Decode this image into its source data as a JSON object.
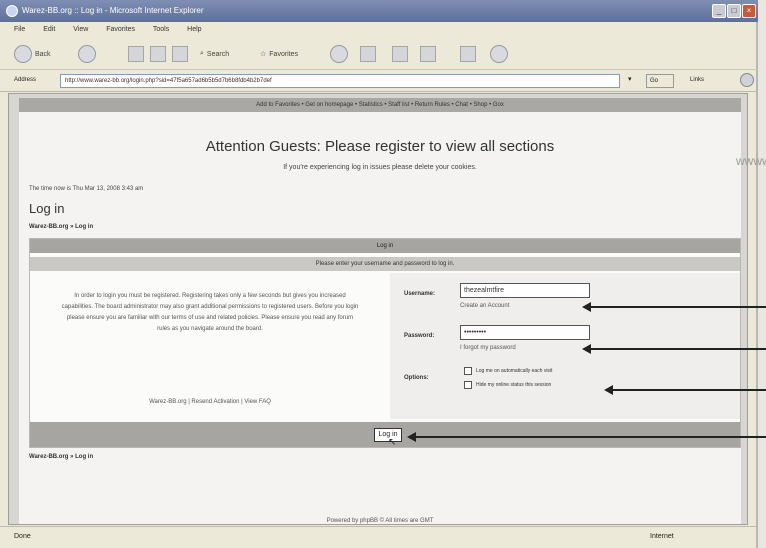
{
  "window": {
    "title": "Warez-BB.org :: Log in - Microsoft Internet Explorer",
    "menu": [
      "File",
      "Edit",
      "View",
      "Favorites",
      "Tools",
      "Help"
    ],
    "toolbar": {
      "back": "Back",
      "search": "Search",
      "favorites": "Favorites"
    },
    "address_label": "Address",
    "address_value": "http://www.warez-bb.org/login.php?sid=47f5a657ad6b5b5d7b6b8fdb4b2b7def",
    "go_label": "Go",
    "links_label": "Links",
    "status_left": "Done",
    "status_right": "Internet"
  },
  "page": {
    "navbar": "Add to Favorites • Get on homepage • Statistics • Staff list • Return Rules • Chat • Shop • Gox",
    "headline": "Attention Guests: Please register to view all sections",
    "subline": "If you're experiencing log in issues please delete your cookies.",
    "timestamp": "The time now is Thu Mar 13, 2008 3:43 am",
    "title": "Log in",
    "breadcrumb": "Warez-BB.org » Log in",
    "panel": {
      "header": "Log in",
      "instruction": "Please enter your username and password to log in.",
      "info": "In order to login you must be registered. Registering takes only a few seconds but gives you increased capabilities. The board administrator may also grant additional permissions to registered users. Before you login please ensure you are familiar with our terms of use and related policies. Please ensure you read any forum rules as you navigate around the board.",
      "links": "Warez-BB.org | Resend Activation | View FAQ",
      "username_label": "Username:",
      "username_value": "thezealmtfire",
      "create_account": "Create an Account",
      "password_label": "Password:",
      "password_value": "•••••••••",
      "forgot_password": "I forgot my password",
      "options_label": "Options:",
      "option_auto": "Log me on automatically each visit",
      "option_hide": "Hide my online status this session",
      "login_button": "Log in"
    },
    "powered": "Powered by phpBB © All times are GMT",
    "bg_text": "wwwww uuu"
  }
}
